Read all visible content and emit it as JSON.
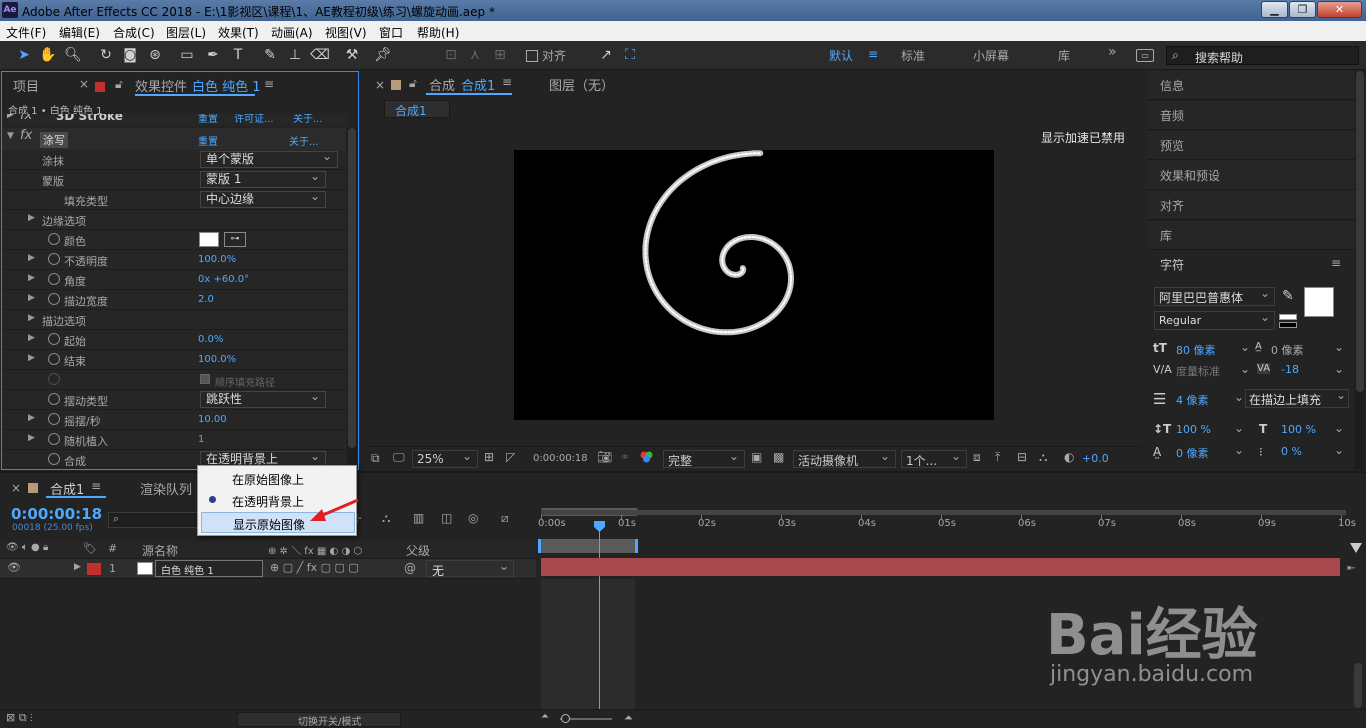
{
  "titlebar": {
    "app_icon": "Ae",
    "title": "Adobe After Effects CC 2018 - E:\\1影视区\\课程\\1、AE教程初级\\练习\\螺旋动画.aep *",
    "minimize_icon": "minimize-icon",
    "restore_icon": "restore-icon",
    "close_icon": "close-icon"
  },
  "menu": [
    "文件(F)",
    "编辑(E)",
    "合成(C)",
    "图层(L)",
    "效果(T)",
    "动画(A)",
    "视图(V)",
    "窗口",
    "帮助(H)"
  ],
  "toolbar": {
    "snap_label": "对齐",
    "workspaces": [
      "默认",
      "标准",
      "小屏幕",
      "库"
    ],
    "more_label": "»",
    "search_placeholder": "搜索帮助"
  },
  "left_panel": {
    "tab_project": "项目",
    "tab_effects": "效果控件",
    "tab_effects_layer": "白色 纯色 1",
    "breadcrumb": "合成 1 • 白色 纯色 1",
    "cut_row": "3D Stroke",
    "cut_row_reset": "重置",
    "cut_row_license": "许可证...",
    "cut_row_about": "关于...",
    "effect_name": "涂写",
    "effect_reset": "重置",
    "effect_about": "关于...",
    "props": [
      {
        "label": "涂抹",
        "dropdown": "单个蒙版"
      },
      {
        "label": "蒙版",
        "dropdown": "蒙版 1"
      },
      {
        "label": "填充类型",
        "dropdown": "中心边缘"
      },
      {
        "label": "边缘选项",
        "value": ""
      },
      {
        "label": "颜色",
        "value": ""
      },
      {
        "label": "不透明度",
        "value": "100.0%"
      },
      {
        "label": "角度",
        "value": "0x +60.0°"
      },
      {
        "label": "描边宽度",
        "value": "2.0"
      },
      {
        "label": "描边选项",
        "value": ""
      },
      {
        "label": "起始",
        "value": "0.0%"
      },
      {
        "label": "结束",
        "value": "100.0%"
      },
      {
        "label": "",
        "value": "顺序填充路径"
      },
      {
        "label": "摆动类型",
        "dropdown": "跳跃性"
      },
      {
        "label": "摇摆/秒",
        "value": "10.00"
      },
      {
        "label": "随机植入",
        "value": "1"
      },
      {
        "label": "合成",
        "dropdown": "在透明背景上"
      }
    ]
  },
  "popup": {
    "items": [
      "在原始图像上",
      "在透明背景上",
      "显示原始图像"
    ],
    "selected_index": 1,
    "hover_index": 2
  },
  "comp": {
    "tab_label": "合成",
    "tab_name": "合成1",
    "layer_tab": "图层（无）",
    "sub_tab": "合成1",
    "gpu_notice": "显示加速已禁用",
    "zoom": "25%",
    "timecode": "0:00:00:18",
    "resolution": "完整",
    "camera": "活动摄像机",
    "views": "1个...",
    "exposure": "+0.0"
  },
  "right_panel": {
    "items": [
      "信息",
      "音频",
      "预览",
      "效果和预设",
      "对齐",
      "库"
    ],
    "char_title": "字符",
    "font": "阿里巴巴普惠体",
    "style": "Regular",
    "font_size": "80 像素",
    "leading": "0 像素",
    "kerning": "度量标准",
    "tracking": "-18",
    "stroke_width": "4 像素",
    "stroke_mode": "在描边上填充",
    "vscale": "100 %",
    "hscale": "100 %",
    "baseline": "0 像素",
    "tsume": "0 %"
  },
  "timeline": {
    "tab_comp": "合成1",
    "tab_render": "渲染队列",
    "timecode": "0:00:00:18",
    "fps": "00018 (25.00 fps)",
    "col_source": "源名称",
    "col_parent": "父级",
    "layer_num": "1",
    "layer_name": "白色 纯色 1",
    "parent_value": "无",
    "ruler": [
      "0:00s",
      "01s",
      "02s",
      "03s",
      "04s",
      "05s",
      "06s",
      "07s",
      "08s",
      "09s",
      "10s"
    ],
    "footer_toggle": "切换开关/模式"
  },
  "watermark": {
    "brand": "Bai经验",
    "url": "jingyan.baidu.com"
  },
  "colors": {
    "accent": "#4fa8ff",
    "layer_bar": "#a8474d",
    "layer_label": "#c0302e",
    "panel": "#232323"
  }
}
